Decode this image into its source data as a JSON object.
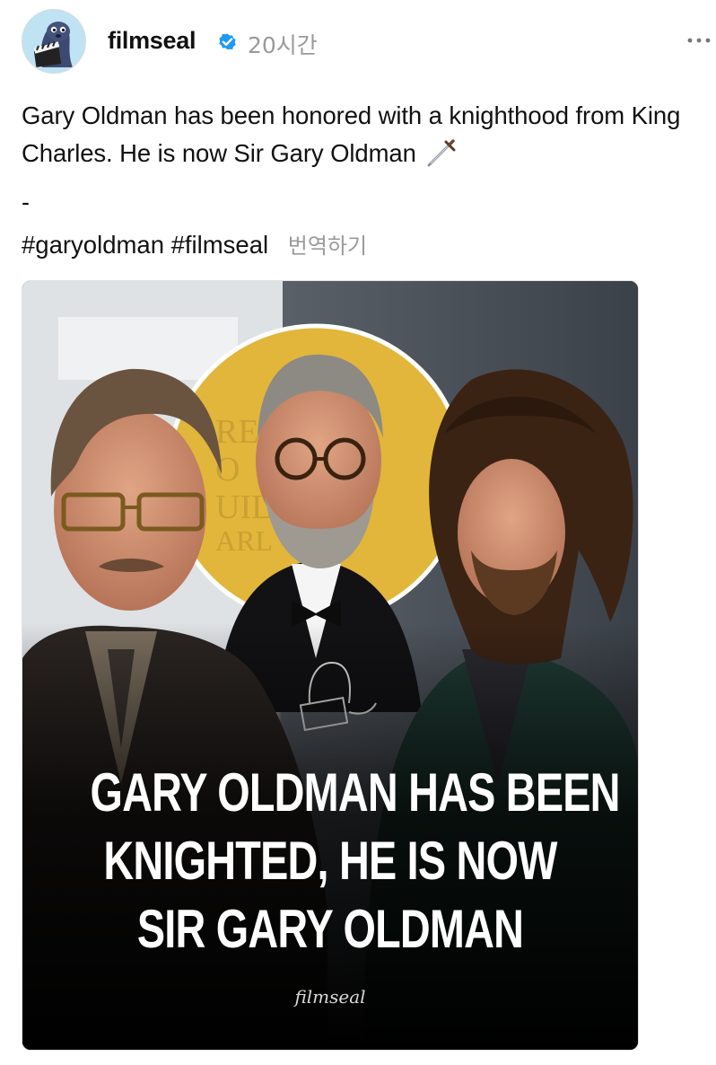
{
  "post": {
    "author": {
      "username": "filmseal",
      "verified_icon": "verified-badge-icon",
      "avatar_icon": "seal-mascot-avatar"
    },
    "timestamp": "20시간",
    "more_icon": "more-horizontal-icon",
    "caption": {
      "text": "Gary Oldman has been honored with a knighthood from King Charles. He is now Sir Gary Oldman",
      "emoji_icon": "dagger-icon",
      "separator": "-",
      "hashtags": [
        "#garyoldman",
        "#filmseal"
      ],
      "translate_label": "번역하기"
    },
    "image": {
      "headline_lines": [
        "GARY OLDMAN HAS BEEN",
        "KNIGHTED, HE IS NOW",
        "SIR GARY OLDMAN"
      ],
      "watermark": "filmseal"
    }
  },
  "colors": {
    "verified_blue": "#1d9bf0",
    "timestamp_gray": "#9a9a9a",
    "image_gold_circle": "#e2b63a",
    "headline_white": "#ffffff"
  }
}
